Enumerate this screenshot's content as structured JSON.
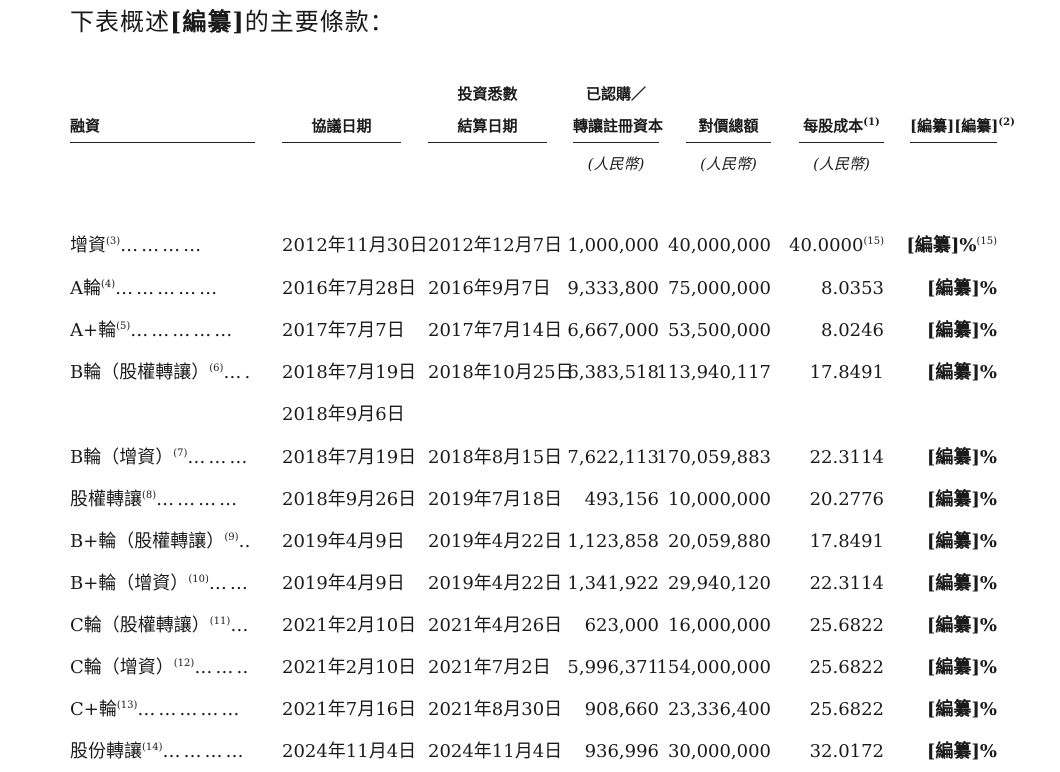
{
  "intro": {
    "prefix": "下表概述",
    "bracket_text": "[編纂]",
    "suffix": "的主要條款："
  },
  "header": {
    "financing": "融資",
    "agreement_date": "協議日期",
    "settlement_line1": "投資悉數",
    "settlement_line2": "結算日期",
    "capital_line1": "已認購／",
    "capital_line2": "轉讓註冊資本",
    "consideration": "對價總額",
    "cost_per_share": "每股成本",
    "cost_note": "(1)",
    "redacted": "[編纂][編纂]",
    "redacted_note": "(2)"
  },
  "units": {
    "capital": "(人民幣)",
    "consideration": "(人民幣)",
    "cost": "(人民幣)"
  },
  "rows": [
    {
      "name": "增資",
      "note": "(3)",
      "dots": "…………",
      "date": "2012年11月30日",
      "date2": "",
      "settle": "2012年12月7日",
      "capital": "1,000,000",
      "consideration": "40,000,000",
      "cost": "40.0000",
      "cost_note": "(15)",
      "pct": "[編纂]%",
      "pct_note": "(15)"
    },
    {
      "name": "A輪",
      "note": "(4)",
      "dots": "……………",
      "date": "2016年7月28日",
      "date2": "",
      "settle": "2016年9月7日",
      "capital": "9,333,800",
      "consideration": "75,000,000",
      "cost": "8.0353",
      "cost_note": "",
      "pct": "[編纂]%",
      "pct_note": ""
    },
    {
      "name": "A+輪",
      "note": "(5)",
      "dots": "……………",
      "date": "2017年7月7日",
      "date2": "",
      "settle": "2017年7月14日",
      "capital": "6,667,000",
      "consideration": "53,500,000",
      "cost": "8.0246",
      "cost_note": "",
      "pct": "[編纂]%",
      "pct_note": ""
    },
    {
      "name": "B輪（股權轉讓）",
      "note": "(6)",
      "dots": "……",
      "date": "2018年7月19日",
      "date2": "2018年9月6日",
      "settle": "2018年10月25日",
      "capital": "6,383,518",
      "consideration": "113,940,117",
      "cost": "17.8491",
      "cost_note": "",
      "pct": "[編纂]%",
      "pct_note": ""
    },
    {
      "name": "B輪（增資）",
      "note": "(7)",
      "dots": "………",
      "date": "2018年7月19日",
      "date2": "",
      "settle": "2018年8月15日",
      "capital": "7,622,113",
      "consideration": "170,059,883",
      "cost": "22.3114",
      "cost_note": "",
      "pct": "[編纂]%",
      "pct_note": ""
    },
    {
      "name": "股權轉讓",
      "note": "(8)",
      "dots": "…………",
      "date": "2018年9月26日",
      "date2": "",
      "settle": "2019年7月18日",
      "capital": "493,156",
      "consideration": "10,000,000",
      "cost": "20.2776",
      "cost_note": "",
      "pct": "[編纂]%",
      "pct_note": ""
    },
    {
      "name": "B+輪（股權轉讓）",
      "note": "(9)",
      "dots": "……",
      "date": "2019年4月9日",
      "date2": "",
      "settle": "2019年4月22日",
      "capital": "1,123,858",
      "consideration": "20,059,880",
      "cost": "17.8491",
      "cost_note": "",
      "pct": "[編纂]%",
      "pct_note": ""
    },
    {
      "name": "B+輪（增資）",
      "note": "(10)",
      "dots": "………",
      "date": "2019年4月9日",
      "date2": "",
      "settle": "2019年4月22日",
      "capital": "1,341,922",
      "consideration": "29,940,120",
      "cost": "22.3114",
      "cost_note": "",
      "pct": "[編纂]%",
      "pct_note": ""
    },
    {
      "name": "C輪（股權轉讓）",
      "note": "(11)",
      "dots": "……",
      "date": "2021年2月10日",
      "date2": "",
      "settle": "2021年4月26日",
      "capital": "623,000",
      "consideration": "16,000,000",
      "cost": "25.6822",
      "cost_note": "",
      "pct": "[編纂]%",
      "pct_note": ""
    },
    {
      "name": "C輪（增資）",
      "note": "(12)",
      "dots": "………",
      "date": "2021年2月10日",
      "date2": "",
      "settle": "2021年7月2日",
      "capital": "5,996,371",
      "consideration": "154,000,000",
      "cost": "25.6822",
      "cost_note": "",
      "pct": "[編纂]%",
      "pct_note": ""
    },
    {
      "name": "C+輪",
      "note": "(13)",
      "dots": "……………",
      "date": "2021年7月16日",
      "date2": "",
      "settle": "2021年8月30日",
      "capital": "908,660",
      "consideration": "23,336,400",
      "cost": "25.6822",
      "cost_note": "",
      "pct": "[編纂]%",
      "pct_note": ""
    },
    {
      "name": "股份轉讓",
      "note": "(14)",
      "dots": "…………",
      "date": "2024年11月4日",
      "date2": "",
      "settle": "2024年11月4日",
      "capital": "936,996",
      "consideration": "30,000,000",
      "cost": "32.0172",
      "cost_note": "",
      "pct": "[編纂]%",
      "pct_note": ""
    }
  ]
}
